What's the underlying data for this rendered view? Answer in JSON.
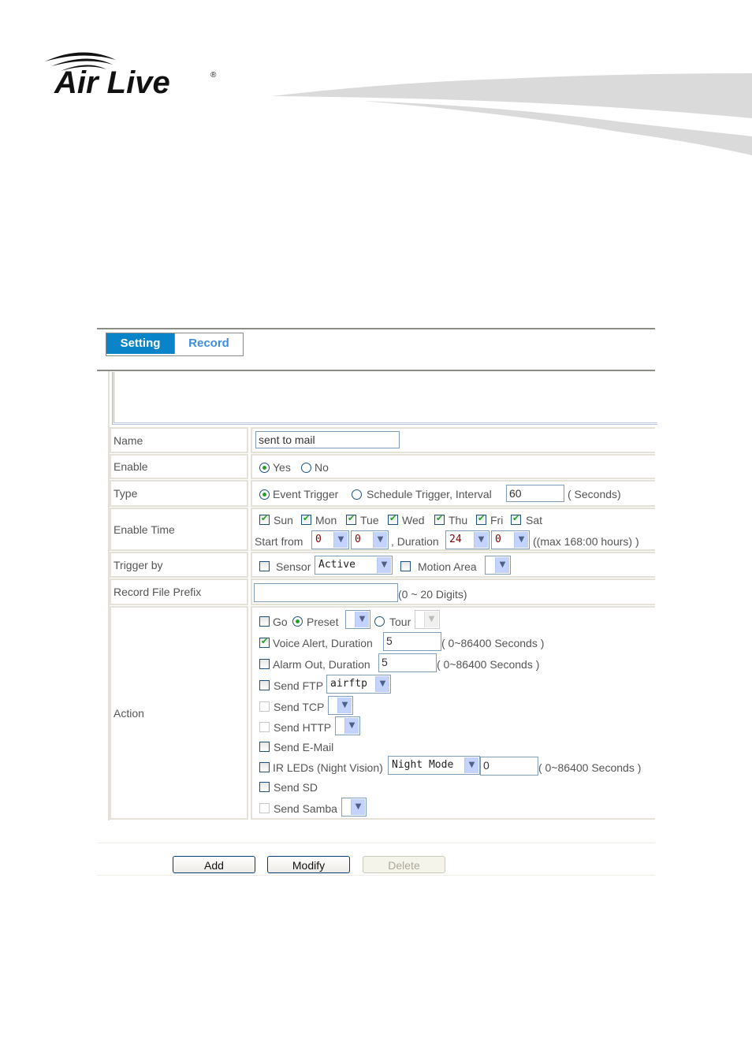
{
  "brand": {
    "name": "Air Live",
    "registered_mark": "®"
  },
  "tabs": [
    {
      "label": "Setting",
      "active": true
    },
    {
      "label": "Record",
      "active": false
    }
  ],
  "form": {
    "name": {
      "label": "Name",
      "value": "sent to mail"
    },
    "enable": {
      "label": "Enable",
      "options": [
        "Yes",
        "No"
      ],
      "selected": "Yes"
    },
    "type": {
      "label": "Type",
      "event_trigger_label": "Event Trigger",
      "schedule_trigger_label": "Schedule Trigger, Interval",
      "selected": "Event Trigger",
      "interval_value": "60",
      "interval_unit": "( Seconds)"
    },
    "enable_time": {
      "label": "Enable Time",
      "days": [
        {
          "label": "Sun",
          "checked": true
        },
        {
          "label": "Mon",
          "checked": true
        },
        {
          "label": "Tue",
          "checked": true
        },
        {
          "label": "Wed",
          "checked": true
        },
        {
          "label": "Thu",
          "checked": true
        },
        {
          "label": "Fri",
          "checked": true
        },
        {
          "label": "Sat",
          "checked": true
        }
      ],
      "start_from_label": "Start from",
      "start_hour": "0",
      "start_minute": "0",
      "duration_label": ", Duration",
      "duration_hour": "24",
      "duration_minute": "0",
      "max_note": "((max 168:00 hours) )"
    },
    "trigger_by": {
      "label": "Trigger by",
      "sensor_label": "Sensor",
      "sensor_checked": false,
      "sensor_mode": "Active",
      "motion_area_label": "Motion Area",
      "motion_area_checked": false,
      "motion_area_value": ""
    },
    "record_file_prefix": {
      "label": "Record File Prefix",
      "value": "",
      "hint": "(0 ~ 20 Digits)"
    },
    "action": {
      "label": "Action",
      "go": {
        "label": "Go",
        "checked": false,
        "preset_label": "Preset",
        "tour_label": "Tour",
        "selected": "Preset"
      },
      "voice_alert": {
        "label": "Voice Alert, Duration",
        "checked": true,
        "value": "5",
        "hint": "( 0~86400 Seconds )"
      },
      "alarm_out": {
        "label": "Alarm Out, Duration",
        "checked": false,
        "value": "5",
        "hint": "( 0~86400 Seconds )"
      },
      "send_ftp": {
        "label": "Send FTP",
        "checked": false,
        "server": "airftp"
      },
      "send_tcp": {
        "label": "Send TCP",
        "checked": false,
        "disabled": true
      },
      "send_http": {
        "label": "Send HTTP",
        "checked": false,
        "disabled": true
      },
      "send_email": {
        "label": "Send E-Mail",
        "checked": false
      },
      "ir_leds": {
        "label": "IR LEDs (Night Vision)",
        "checked": false,
        "mode": "Night Mode",
        "value": "0",
        "hint": "( 0~86400 Seconds )"
      },
      "send_sd": {
        "label": "Send SD",
        "checked": false
      },
      "send_samba": {
        "label": "Send Samba",
        "checked": false,
        "disabled": true
      }
    }
  },
  "buttons": {
    "add": "Add",
    "modify": "Modify",
    "delete": "Delete"
  }
}
